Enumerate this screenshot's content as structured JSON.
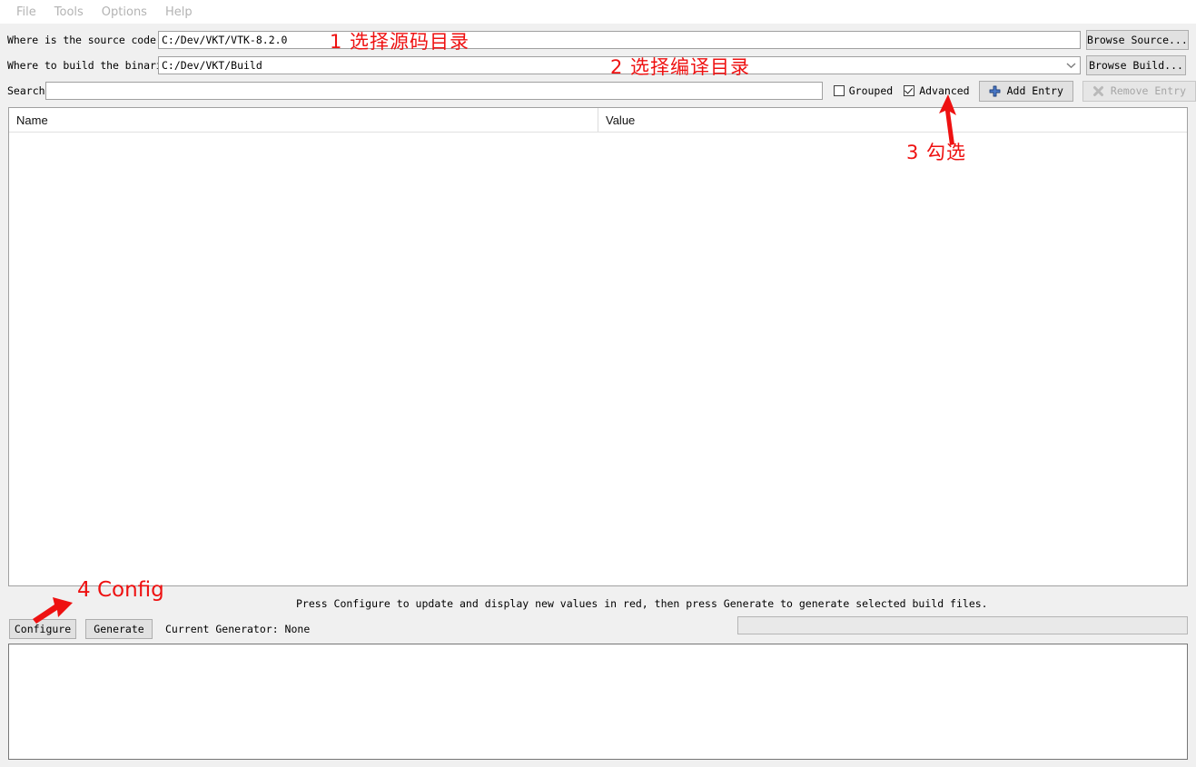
{
  "window": {
    "title": "CMake",
    "accent_red": "#ee1111",
    "button_face": "#e1e1e1",
    "panel_bg": "#f0f0f0"
  },
  "menubar": {
    "items": [
      {
        "label": "File"
      },
      {
        "label": "Tools"
      },
      {
        "label": "Options"
      },
      {
        "label": "Help"
      }
    ]
  },
  "source_row": {
    "label": "Where is the source code:",
    "value": "C:/Dev/VKT/VTK-8.2.0",
    "placeholder": "",
    "browse_label": "Browse Source..."
  },
  "build_row": {
    "label": "Where to build the binaries:",
    "value": "C:/Dev/VKT/Build",
    "placeholder": "",
    "browse_label": "Browse Build...",
    "dropdown_icon": "chevron-down-icon"
  },
  "search_row": {
    "label": "Search:",
    "value": "",
    "placeholder": "",
    "grouped": {
      "label": "Grouped",
      "checked": false
    },
    "advanced": {
      "label": "Advanced",
      "checked": true
    },
    "add_entry": {
      "label": "Add Entry",
      "icon": "plus-icon",
      "enabled": true
    },
    "remove_entry": {
      "label": "Remove Entry",
      "icon": "remove-icon",
      "enabled": false
    }
  },
  "cache_table": {
    "columns": [
      {
        "key": "name",
        "label": "Name"
      },
      {
        "key": "value",
        "label": "Value"
      }
    ],
    "rows": []
  },
  "bottom": {
    "hint": "Press Configure to update and display new values in red, then press Generate to generate selected build files.",
    "configure_label": "Configure",
    "generate_label": "Generate",
    "current_generator": "Current Generator: None",
    "progress_value": 0
  },
  "output_log": {
    "lines": []
  },
  "annotations": [
    {
      "id": "1",
      "text": "1 选择源码目录"
    },
    {
      "id": "2",
      "text": "2 选择编译目录"
    },
    {
      "id": "3",
      "text": "3 勾选"
    },
    {
      "id": "4",
      "text": "4 Config"
    }
  ]
}
